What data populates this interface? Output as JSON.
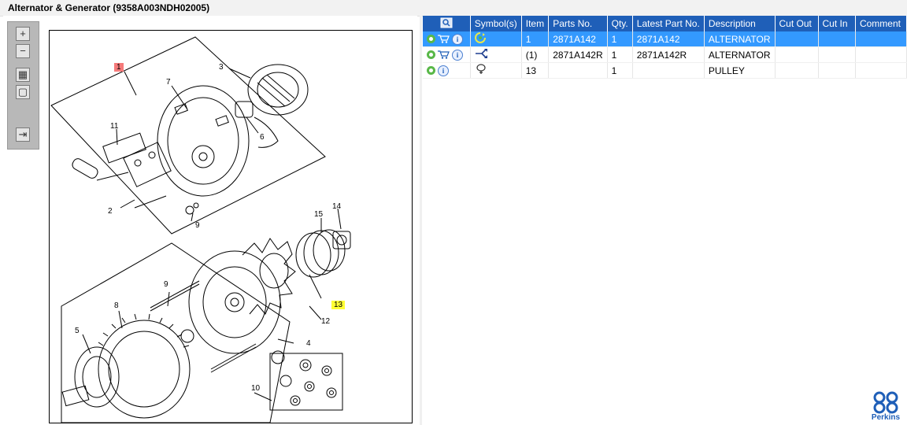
{
  "window": {
    "title": "Alternator & Generator (9358A003NDH02005)"
  },
  "toolbar": {
    "buttons": [
      {
        "name": "zoom-in-button",
        "glyph": "+"
      },
      {
        "name": "zoom-out-button",
        "glyph": "−"
      },
      {
        "name": "fit-page-button",
        "glyph": "▦"
      },
      {
        "name": "actual-size-button",
        "glyph": "▢"
      },
      {
        "name": "export-button",
        "glyph": "⇥"
      }
    ]
  },
  "diagram": {
    "callouts": [
      {
        "id": "1",
        "label": "1",
        "highlight": "red"
      },
      {
        "id": "2",
        "label": "2",
        "highlight": "none"
      },
      {
        "id": "3",
        "label": "3",
        "highlight": "none"
      },
      {
        "id": "4",
        "label": "4",
        "highlight": "none"
      },
      {
        "id": "5",
        "label": "5",
        "highlight": "none"
      },
      {
        "id": "6",
        "label": "6",
        "highlight": "none"
      },
      {
        "id": "7",
        "label": "7",
        "highlight": "none"
      },
      {
        "id": "8",
        "label": "8",
        "highlight": "none"
      },
      {
        "id": "9a",
        "label": "9",
        "highlight": "none"
      },
      {
        "id": "9b",
        "label": "9",
        "highlight": "none"
      },
      {
        "id": "10",
        "label": "10",
        "highlight": "none"
      },
      {
        "id": "11",
        "label": "11",
        "highlight": "none"
      },
      {
        "id": "12",
        "label": "12",
        "highlight": "none"
      },
      {
        "id": "13",
        "label": "13",
        "highlight": "yellow"
      },
      {
        "id": "14",
        "label": "14",
        "highlight": "none"
      },
      {
        "id": "15",
        "label": "15",
        "highlight": "none"
      }
    ]
  },
  "parts_table": {
    "columns": [
      "Symbol(s)",
      "Item",
      "Parts No.",
      "Qty.",
      "Latest Part No.",
      "Description",
      "Cut Out",
      "Cut In",
      "Comment"
    ],
    "rows": [
      {
        "selected": true,
        "icons": [
          "gear-icon",
          "cart-icon",
          "info-icon"
        ],
        "symbol": "recycle-symbol-icon",
        "item": "1",
        "part_no": "2871A142",
        "qty": "1",
        "latest_part_no": "2871A142",
        "description": "ALTERNATOR",
        "cut_out": "",
        "cut_in": "",
        "comment": ""
      },
      {
        "selected": false,
        "icons": [
          "gear-icon",
          "cart-icon",
          "info-icon"
        ],
        "symbol": "split-arrow-icon",
        "item": "(1)",
        "part_no": "2871A142R",
        "qty": "1",
        "latest_part_no": "2871A142R",
        "description": "ALTERNATOR",
        "cut_out": "",
        "cut_in": "",
        "comment": ""
      },
      {
        "selected": false,
        "icons": [
          "gear-icon",
          "info-icon"
        ],
        "symbol": "tag-icon",
        "item": "13",
        "part_no": "",
        "qty": "1",
        "latest_part_no": "",
        "description": "PULLEY",
        "cut_out": "",
        "cut_in": "",
        "comment": ""
      }
    ]
  },
  "brand": {
    "name": "Perkins",
    "color": "#1f5fb8"
  },
  "colors": {
    "header": "#1f5fb8",
    "selected_row": "#3399ff",
    "callout_red": "#f57a7a",
    "callout_yellow": "#ffff33"
  }
}
